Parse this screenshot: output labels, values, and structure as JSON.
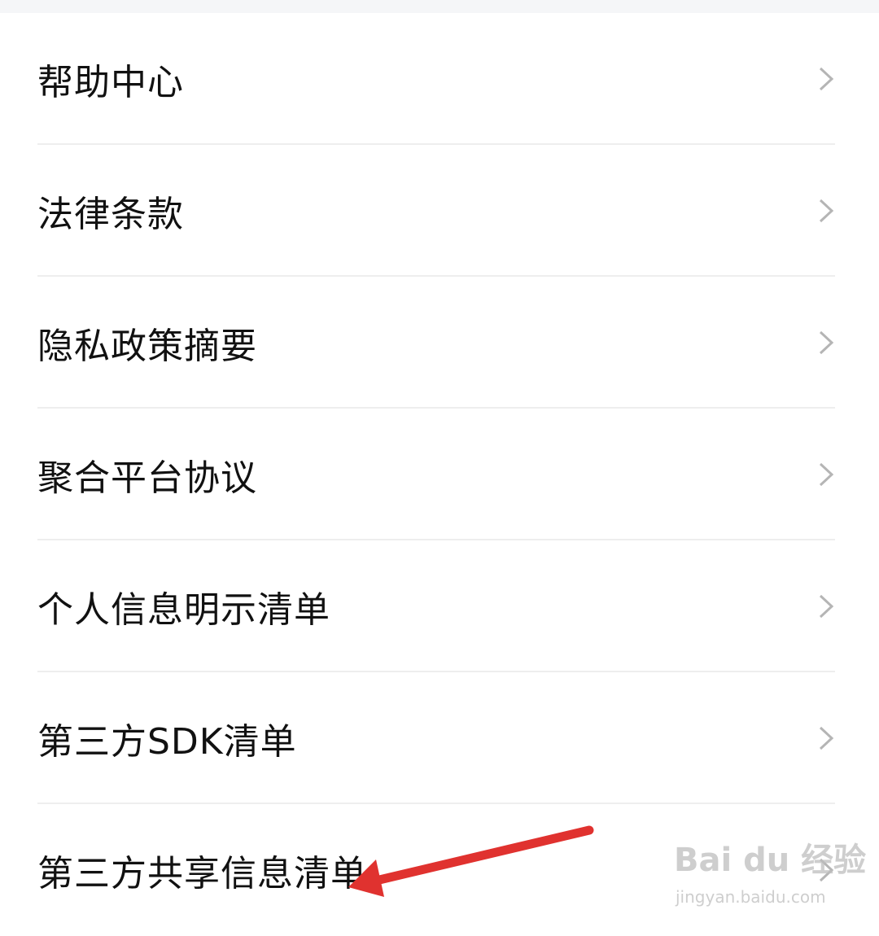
{
  "menu": {
    "items": [
      {
        "label": "帮助中心",
        "icon": "chevron-right-icon"
      },
      {
        "label": "法律条款",
        "icon": "chevron-right-icon"
      },
      {
        "label": "隐私政策摘要",
        "icon": "chevron-right-icon"
      },
      {
        "label": "聚合平台协议",
        "icon": "chevron-right-icon"
      },
      {
        "label": "个人信息明示清单",
        "icon": "chevron-right-icon"
      },
      {
        "label": "第三方SDK清单",
        "icon": "chevron-right-icon"
      },
      {
        "label": "第三方共享信息清单",
        "icon": "chevron-right-icon"
      }
    ]
  },
  "annotation": {
    "type": "arrow",
    "color": "#e0322f",
    "points_to": "第三方共享信息清单"
  },
  "watermark": {
    "logo": "Bai du 经验",
    "url": "jingyan.baidu.com"
  },
  "colors": {
    "text": "#111111",
    "chevron": "#b5b5b5",
    "divider": "#eeeeee",
    "top_bar": "#f5f6f8"
  }
}
